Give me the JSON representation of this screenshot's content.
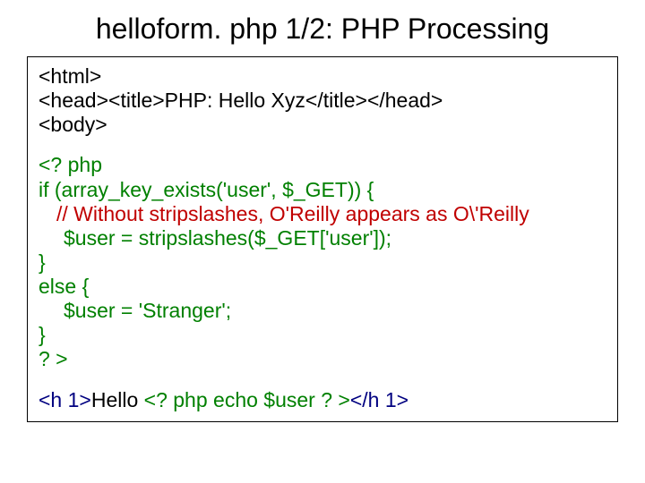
{
  "title": "helloform. php 1/2: PHP Processing",
  "code": {
    "l1": "<html>",
    "l2": "<head><title>PHP: Hello Xyz</title></head>",
    "l3": "<body>",
    "l4": "<? php",
    "l5": "if (array_key_exists('user', $_GET)) {",
    "l6": "// Without stripslashes, O'Reilly appears as O\\'Reilly",
    "l7": "$user = stripslashes($_GET['user']);",
    "l8": "}",
    "l9": "else {",
    "l10": "$user = 'Stranger';",
    "l11": "}",
    "l12": "? >",
    "l13a": "<h 1>",
    "l13b": "Hello ",
    "l13c": "<? php  echo $user  ? >",
    "l13d": "</h 1>"
  }
}
